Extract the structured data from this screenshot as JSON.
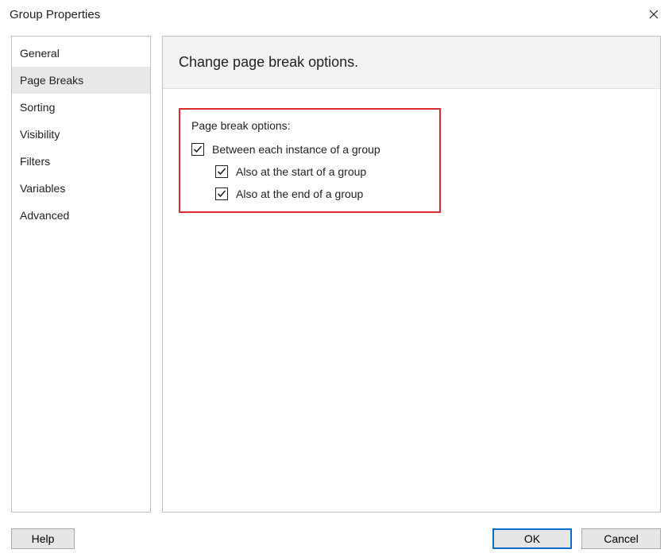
{
  "title": "Group Properties",
  "sidebar": {
    "items": [
      {
        "label": "General"
      },
      {
        "label": "Page Breaks"
      },
      {
        "label": "Sorting"
      },
      {
        "label": "Visibility"
      },
      {
        "label": "Filters"
      },
      {
        "label": "Variables"
      },
      {
        "label": "Advanced"
      }
    ],
    "selected": 1
  },
  "panel": {
    "heading": "Change page break options.",
    "section_label": "Page break options:",
    "checkboxes": [
      {
        "label": "Between each instance of a group",
        "checked": true
      },
      {
        "label": "Also at the start of a group",
        "checked": true
      },
      {
        "label": "Also at the end of a group",
        "checked": true
      }
    ]
  },
  "buttons": {
    "help": "Help",
    "ok": "OK",
    "cancel": "Cancel"
  }
}
